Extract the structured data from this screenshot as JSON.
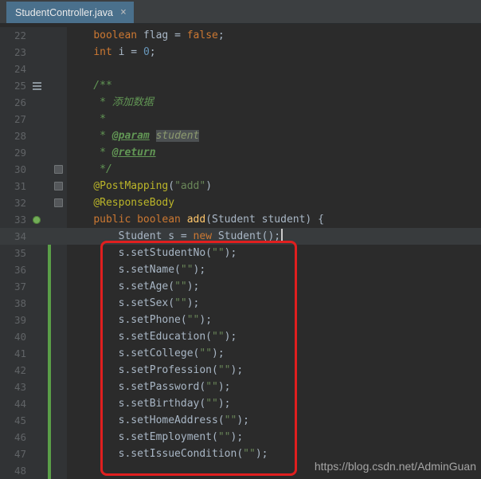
{
  "tab_bar": {
    "active_tab": "StudentController.java",
    "close_glyph": "×"
  },
  "watermark": "https://blog.csdn.net/AdminGuan",
  "colors": {
    "editor_bg": "#2b2b2b",
    "gutter_bg": "#313335",
    "current_line_bg": "#383b3d",
    "tab_active_bg": "#4a708c",
    "annotation_red": "#e01f1f",
    "vcs_added_green": "#5a9e48",
    "keyword": "#cc7832",
    "string": "#6a8759",
    "annotation_yellow": "#bbb529",
    "comment_green": "#629755",
    "method_yellow": "#ffc66b",
    "number_blue": "#6897bb",
    "default_text": "#a9b7c6"
  },
  "editor": {
    "current_line": 34,
    "lines": [
      {
        "n": 22,
        "seg": [
          {
            "t": "    "
          },
          {
            "s": "kw",
            "t": "boolean"
          },
          {
            "t": " flag = "
          },
          {
            "s": "kw",
            "t": "false"
          },
          {
            "t": ";"
          }
        ]
      },
      {
        "n": 23,
        "seg": [
          {
            "t": "    "
          },
          {
            "s": "kw",
            "t": "int"
          },
          {
            "t": " i = "
          },
          {
            "s": "num",
            "t": "0"
          },
          {
            "t": ";"
          }
        ]
      },
      {
        "n": 24,
        "seg": []
      },
      {
        "n": 25,
        "icon": "doc-toggle",
        "seg": [
          {
            "s": "doc",
            "t": "    /**"
          }
        ]
      },
      {
        "n": 26,
        "seg": [
          {
            "s": "doc",
            "t": "     * 添加数据"
          }
        ]
      },
      {
        "n": 27,
        "seg": [
          {
            "s": "doc",
            "t": "     *"
          }
        ]
      },
      {
        "n": 28,
        "seg": [
          {
            "s": "doc",
            "t": "     * "
          },
          {
            "s": "doctag",
            "t": "@param"
          },
          {
            "s": "doc",
            "t": " "
          },
          {
            "s": "docval",
            "t": "student"
          }
        ]
      },
      {
        "n": 29,
        "seg": [
          {
            "s": "doc",
            "t": "     * "
          },
          {
            "s": "doctag",
            "t": "@return"
          }
        ]
      },
      {
        "n": 30,
        "fold": true,
        "seg": [
          {
            "s": "doc",
            "t": "     */"
          }
        ]
      },
      {
        "n": 31,
        "fold": true,
        "seg": [
          {
            "t": "    "
          },
          {
            "s": "ann",
            "t": "@PostMapping"
          },
          {
            "t": "("
          },
          {
            "s": "str",
            "t": "\"add\""
          },
          {
            "t": ")"
          }
        ]
      },
      {
        "n": 32,
        "fold": true,
        "seg": [
          {
            "t": "    "
          },
          {
            "s": "ann",
            "t": "@ResponseBody"
          }
        ]
      },
      {
        "n": 33,
        "icon": "spring",
        "seg": [
          {
            "t": "    "
          },
          {
            "s": "kw",
            "t": "public boolean "
          },
          {
            "s": "meth",
            "t": "add"
          },
          {
            "t": "(Student student) {"
          }
        ]
      },
      {
        "n": 34,
        "current": true,
        "caret": true,
        "seg": [
          {
            "t": "        Student s = "
          },
          {
            "s": "kw",
            "t": "new"
          },
          {
            "t": " Student();"
          }
        ]
      },
      {
        "n": 35,
        "vcs": true,
        "seg": [
          {
            "t": "        s.setStudentNo("
          },
          {
            "s": "str",
            "t": "\"\""
          },
          {
            "t": ");"
          }
        ]
      },
      {
        "n": 36,
        "vcs": true,
        "seg": [
          {
            "t": "        s.setName("
          },
          {
            "s": "str",
            "t": "\"\""
          },
          {
            "t": ");"
          }
        ]
      },
      {
        "n": 37,
        "vcs": true,
        "seg": [
          {
            "t": "        s.setAge("
          },
          {
            "s": "str",
            "t": "\"\""
          },
          {
            "t": ");"
          }
        ]
      },
      {
        "n": 38,
        "vcs": true,
        "seg": [
          {
            "t": "        s.setSex("
          },
          {
            "s": "str",
            "t": "\"\""
          },
          {
            "t": ");"
          }
        ]
      },
      {
        "n": 39,
        "vcs": true,
        "seg": [
          {
            "t": "        s.setPhone("
          },
          {
            "s": "str",
            "t": "\"\""
          },
          {
            "t": ");"
          }
        ]
      },
      {
        "n": 40,
        "vcs": true,
        "seg": [
          {
            "t": "        s.setEducation("
          },
          {
            "s": "str",
            "t": "\"\""
          },
          {
            "t": ");"
          }
        ]
      },
      {
        "n": 41,
        "vcs": true,
        "seg": [
          {
            "t": "        s.setCollege("
          },
          {
            "s": "str",
            "t": "\"\""
          },
          {
            "t": ");"
          }
        ]
      },
      {
        "n": 42,
        "vcs": true,
        "seg": [
          {
            "t": "        s.setProfession("
          },
          {
            "s": "str",
            "t": "\"\""
          },
          {
            "t": ");"
          }
        ]
      },
      {
        "n": 43,
        "vcs": true,
        "seg": [
          {
            "t": "        s.setPassword("
          },
          {
            "s": "str",
            "t": "\"\""
          },
          {
            "t": ");"
          }
        ]
      },
      {
        "n": 44,
        "vcs": true,
        "seg": [
          {
            "t": "        s.setBirthday("
          },
          {
            "s": "str",
            "t": "\"\""
          },
          {
            "t": ");"
          }
        ]
      },
      {
        "n": 45,
        "vcs": true,
        "seg": [
          {
            "t": "        s.setHomeAddress("
          },
          {
            "s": "str",
            "t": "\"\""
          },
          {
            "t": ");"
          }
        ]
      },
      {
        "n": 46,
        "vcs": true,
        "seg": [
          {
            "t": "        s.setEmployment("
          },
          {
            "s": "str",
            "t": "\"\""
          },
          {
            "t": ");"
          }
        ]
      },
      {
        "n": 47,
        "vcs": true,
        "seg": [
          {
            "t": "        s.setIssueCondition("
          },
          {
            "s": "str",
            "t": "\"\""
          },
          {
            "t": ");"
          }
        ]
      },
      {
        "n": 48,
        "vcs": true,
        "seg": []
      }
    ]
  }
}
